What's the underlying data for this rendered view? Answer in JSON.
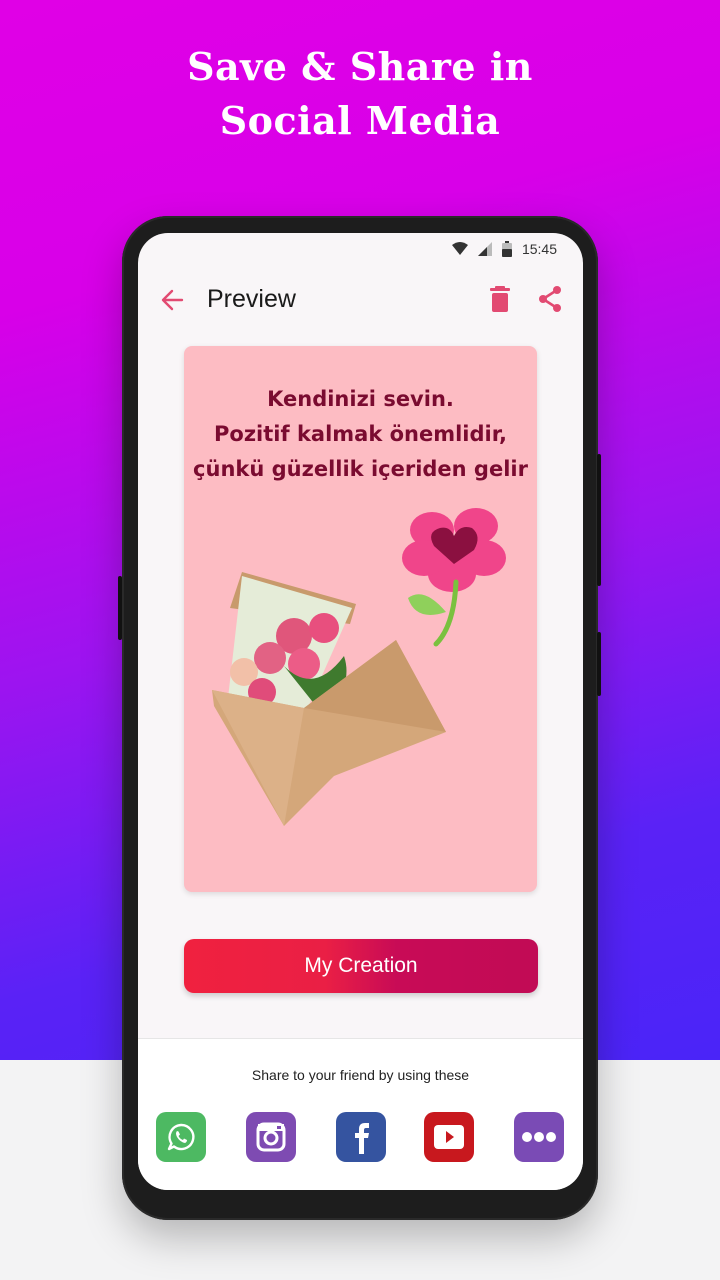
{
  "headline": {
    "line1": "Save & Share in",
    "line2": "Social Media"
  },
  "status_bar": {
    "time": "15:45",
    "icons": [
      "wifi-icon",
      "signal-icon",
      "battery-icon"
    ]
  },
  "app_bar": {
    "title": "Preview",
    "back_icon": "arrow-left-icon",
    "actions": [
      "trash-icon",
      "share-icon"
    ],
    "accent_color": "#e24a72"
  },
  "card": {
    "background_color": "#fdbcc3",
    "quote_lines": [
      "Kendinizi sevin.",
      "Pozitif kalmak önemlidir,",
      "çünkü güzellik içeriden gelir"
    ],
    "quote_color": "#7a0b30",
    "illustration": "envelope-with-roses and heart-flower"
  },
  "primary_button": {
    "label": "My Creation"
  },
  "share_sheet": {
    "label": "Share to your friend by using these",
    "targets": [
      {
        "name": "WhatsApp",
        "icon": "whatsapp-icon",
        "color": "#4db962"
      },
      {
        "name": "Instagram",
        "icon": "instagram-icon",
        "color": "#7e4bb2"
      },
      {
        "name": "Facebook",
        "icon": "facebook-icon",
        "color": "#3554a0"
      },
      {
        "name": "YouTube",
        "icon": "youtube-icon",
        "color": "#c8181e"
      },
      {
        "name": "More",
        "icon": "more-icon",
        "color": "#7a4bb5"
      }
    ]
  }
}
